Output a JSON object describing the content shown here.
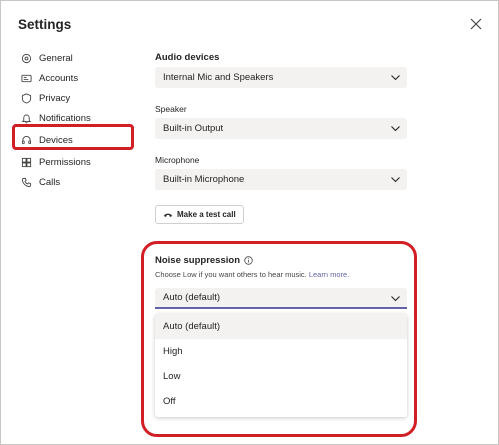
{
  "window": {
    "title": "Settings"
  },
  "sidebar": {
    "items": [
      {
        "label": "General",
        "icon": "gear-icon"
      },
      {
        "label": "Accounts",
        "icon": "id-card-icon"
      },
      {
        "label": "Privacy",
        "icon": "shield-icon"
      },
      {
        "label": "Notifications",
        "icon": "bell-icon"
      },
      {
        "label": "Devices",
        "icon": "headset-icon",
        "active": true
      },
      {
        "label": "Permissions",
        "icon": "grid-icon"
      },
      {
        "label": "Calls",
        "icon": "phone-icon"
      }
    ]
  },
  "audio": {
    "heading": "Audio devices",
    "device_value": "Internal Mic and Speakers",
    "speaker_label": "Speaker",
    "speaker_value": "Built-in Output",
    "microphone_label": "Microphone",
    "microphone_value": "Built-in Microphone",
    "test_call_label": "Make a test call"
  },
  "noise": {
    "heading": "Noise suppression",
    "description": "Choose Low if you want others to hear music.",
    "learn_more": "Learn more.",
    "selected": "Auto (default)",
    "options": [
      "Auto (default)",
      "High",
      "Low",
      "Off"
    ]
  },
  "colors": {
    "accent": "#6264a7",
    "highlight": "#d21f26",
    "field_bg": "#f3f2f1"
  }
}
